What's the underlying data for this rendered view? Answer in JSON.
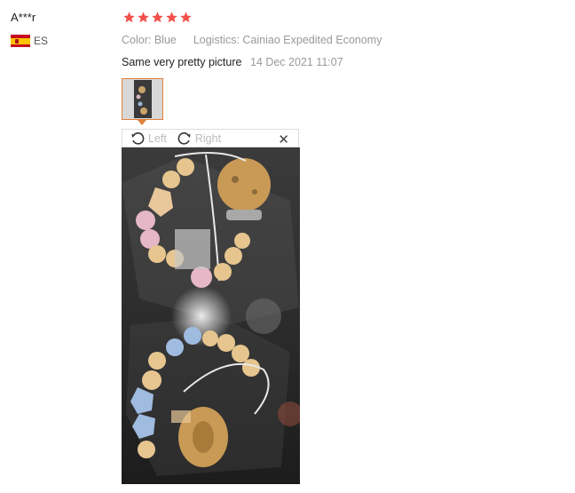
{
  "review": {
    "user_name": "A***r",
    "country_code": "ES",
    "rating": 5,
    "color_label": "Color:",
    "color_value": "Blue",
    "logistics_label": "Logistics:",
    "logistics_value": "Cainiao Expedited Economy",
    "text": "Same very pretty picture",
    "date": "14 Dec 2021 11:07"
  },
  "viewer": {
    "rotate_left_label": "Left",
    "rotate_right_label": "Right",
    "close_label": "✕"
  },
  "colors": {
    "star": "#f2514b",
    "thumb_border": "#e0803a"
  },
  "icons": {
    "rotate_left": "rotate-left-icon",
    "rotate_right": "rotate-right-icon",
    "close": "close-icon",
    "star": "star-icon",
    "flag": "flag-es-icon"
  }
}
